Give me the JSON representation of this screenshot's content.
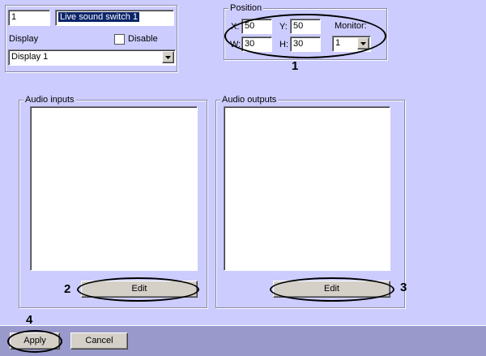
{
  "top": {
    "id_value": "1",
    "name_value": "Live sound switch 1",
    "display_label": "Display",
    "disable_label": "Disable",
    "display_select": "Display 1"
  },
  "position": {
    "legend": "Position",
    "x_label": "X:",
    "x_value": "50",
    "y_label": "Y:",
    "y_value": "50",
    "w_label": "W:",
    "w_value": "30",
    "h_label": "H:",
    "h_value": "30",
    "monitor_label": "Monitor:",
    "monitor_value": "1"
  },
  "audio_inputs": {
    "legend": "Audio inputs",
    "edit_label": "Edit"
  },
  "audio_outputs": {
    "legend": "Audio outputs",
    "edit_label": "Edit"
  },
  "footer": {
    "apply_label": "Apply",
    "cancel_label": "Cancel"
  },
  "callouts": {
    "one": "1",
    "two": "2",
    "three": "3",
    "four": "4"
  },
  "icons": {
    "dropdown": "chevron-down-icon"
  }
}
